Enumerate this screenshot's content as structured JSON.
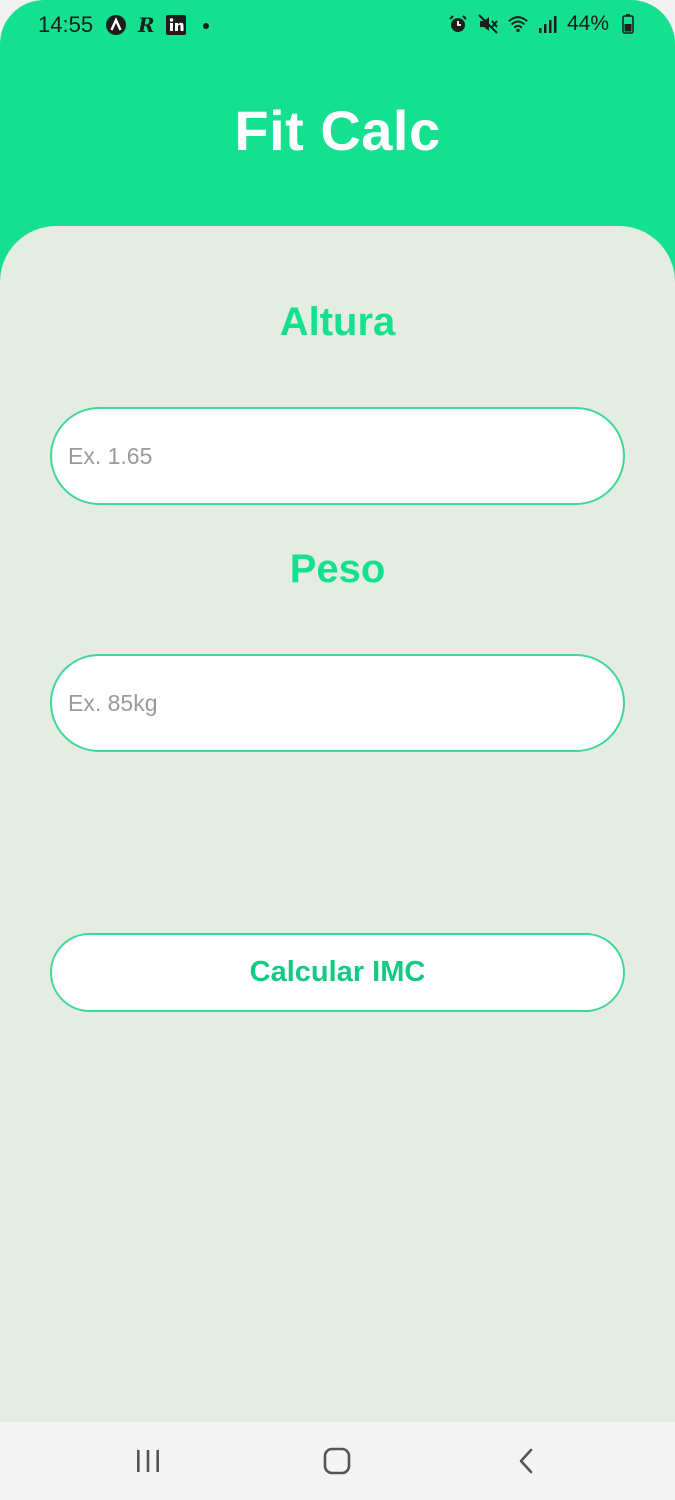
{
  "status_bar": {
    "time": "14:55",
    "battery": "44%",
    "left_icons": [
      "arc-app-icon",
      "r-app-icon",
      "linkedin-icon",
      "notification-dot-icon"
    ],
    "right_icons": [
      "alarm-icon",
      "mute-icon",
      "wifi-icon",
      "signal-icon",
      "battery-icon"
    ]
  },
  "app": {
    "title": "Fit Calc"
  },
  "form": {
    "height_label": "Altura",
    "height_placeholder": "Ex. 1.65",
    "height_value": "",
    "weight_label": "Peso",
    "weight_placeholder": "Ex. 85kg",
    "weight_value": "",
    "calculate_label": "Calcular IMC"
  },
  "nav": {
    "buttons": [
      "recent-apps-icon",
      "home-icon",
      "back-icon"
    ]
  },
  "colors": {
    "brand": "#14e08f",
    "card_bg": "#e5ede2",
    "border": "#3fd79a"
  }
}
